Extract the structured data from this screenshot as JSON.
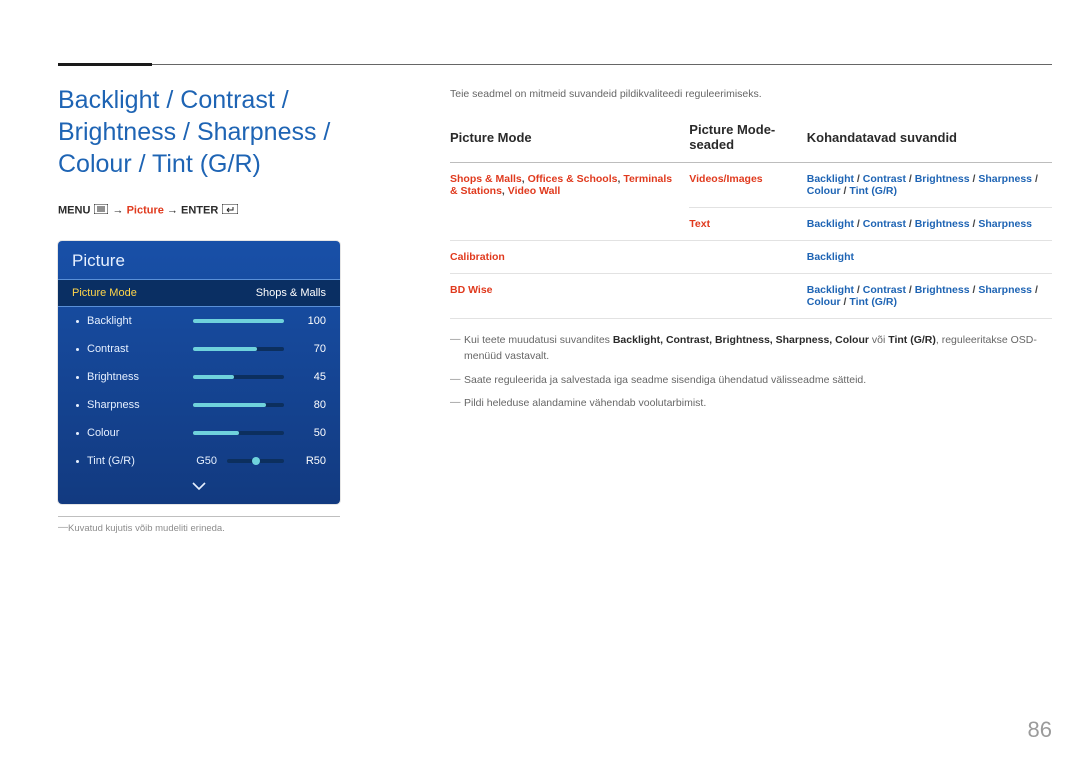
{
  "header": {
    "title": "Backlight / Contrast / Brightness / Sharpness / Colour / Tint (G/R)"
  },
  "nav": {
    "menu_label": "MENU",
    "arrow": "→",
    "picture_label": "Picture",
    "enter_label": "ENTER"
  },
  "osd": {
    "title": "Picture",
    "selected_label": "Picture Mode",
    "selected_value": "Shops & Malls",
    "rows": [
      {
        "name": "Backlight",
        "value": "100",
        "pct": 100
      },
      {
        "name": "Contrast",
        "value": "70",
        "pct": 70
      },
      {
        "name": "Brightness",
        "value": "45",
        "pct": 45
      },
      {
        "name": "Sharpness",
        "value": "80",
        "pct": 80
      },
      {
        "name": "Colour",
        "value": "50",
        "pct": 50
      }
    ],
    "tint": {
      "name": "Tint (G/R)",
      "left": "G50",
      "right": "R50"
    },
    "footnote": "Kuvatud kujutis võib mudeliti erineda."
  },
  "intro": "Teie seadmel on mitmeid suvandeid pildikvaliteedi reguleerimiseks.",
  "table": {
    "headers": [
      "Picture Mode",
      "Picture Mode-seaded",
      "Kohandatavad suvandid"
    ],
    "rows": [
      {
        "mode": [
          {
            "t": "Shops & Malls",
            "c": "red"
          },
          {
            "t": ", ",
            "c": "sep"
          },
          {
            "t": "Offices & Schools",
            "c": "red"
          },
          {
            "t": ", ",
            "c": "sep"
          },
          {
            "t": "Terminals & Stations",
            "c": "red"
          },
          {
            "t": ", ",
            "c": "sep"
          },
          {
            "t": "Video Wall",
            "c": "red"
          }
        ],
        "settings": [
          [
            {
              "t": "Videos/Images",
              "c": "red"
            }
          ],
          [
            {
              "t": "Text",
              "c": "red"
            }
          ]
        ],
        "adjustable": [
          [
            {
              "t": "Backlight",
              "c": "blue"
            },
            {
              "t": " / ",
              "c": "sep"
            },
            {
              "t": "Contrast",
              "c": "blue"
            },
            {
              "t": " / ",
              "c": "sep"
            },
            {
              "t": "Brightness",
              "c": "blue"
            },
            {
              "t": " / ",
              "c": "sep"
            },
            {
              "t": "Sharpness",
              "c": "blue"
            },
            {
              "t": " / ",
              "c": "sep"
            },
            {
              "t": "Colour",
              "c": "blue"
            },
            {
              "t": " / ",
              "c": "sep"
            },
            {
              "t": "Tint (G/R)",
              "c": "blue"
            }
          ],
          [
            {
              "t": "Backlight",
              "c": "blue"
            },
            {
              "t": " / ",
              "c": "sep"
            },
            {
              "t": "Contrast",
              "c": "blue"
            },
            {
              "t": " / ",
              "c": "sep"
            },
            {
              "t": "Brightness",
              "c": "blue"
            },
            {
              "t": " / ",
              "c": "sep"
            },
            {
              "t": "Sharpness",
              "c": "blue"
            }
          ]
        ]
      },
      {
        "mode": [
          {
            "t": "Calibration",
            "c": "red"
          }
        ],
        "settings": [
          []
        ],
        "adjustable": [
          [
            {
              "t": "Backlight",
              "c": "blue"
            }
          ]
        ]
      },
      {
        "mode": [
          {
            "t": "BD Wise",
            "c": "red"
          }
        ],
        "settings": [
          []
        ],
        "adjustable": [
          [
            {
              "t": "Backlight",
              "c": "blue"
            },
            {
              "t": " / ",
              "c": "sep"
            },
            {
              "t": "Contrast",
              "c": "blue"
            },
            {
              "t": " / ",
              "c": "sep"
            },
            {
              "t": "Brightness",
              "c": "blue"
            },
            {
              "t": " / ",
              "c": "sep"
            },
            {
              "t": "Sharpness",
              "c": "blue"
            },
            {
              "t": " / ",
              "c": "sep"
            },
            {
              "t": "Colour",
              "c": "blue"
            },
            {
              "t": " / ",
              "c": "sep"
            },
            {
              "t": "Tint (G/R)",
              "c": "blue"
            }
          ]
        ]
      }
    ]
  },
  "notes": [
    {
      "pre": "Kui teete muudatusi suvandites ",
      "bold": "Backlight, Contrast, Brightness, Sharpness, Colour",
      "mid": " või ",
      "bold2": "Tint (G/R)",
      "post": ", reguleeritakse OSD-menüüd vastavalt."
    },
    {
      "text": "Saate reguleerida ja salvestada iga seadme sisendiga ühendatud välisseadme sätteid."
    },
    {
      "text": "Pildi heleduse alandamine vähendab voolutarbimist."
    }
  ],
  "pageNumber": "86"
}
